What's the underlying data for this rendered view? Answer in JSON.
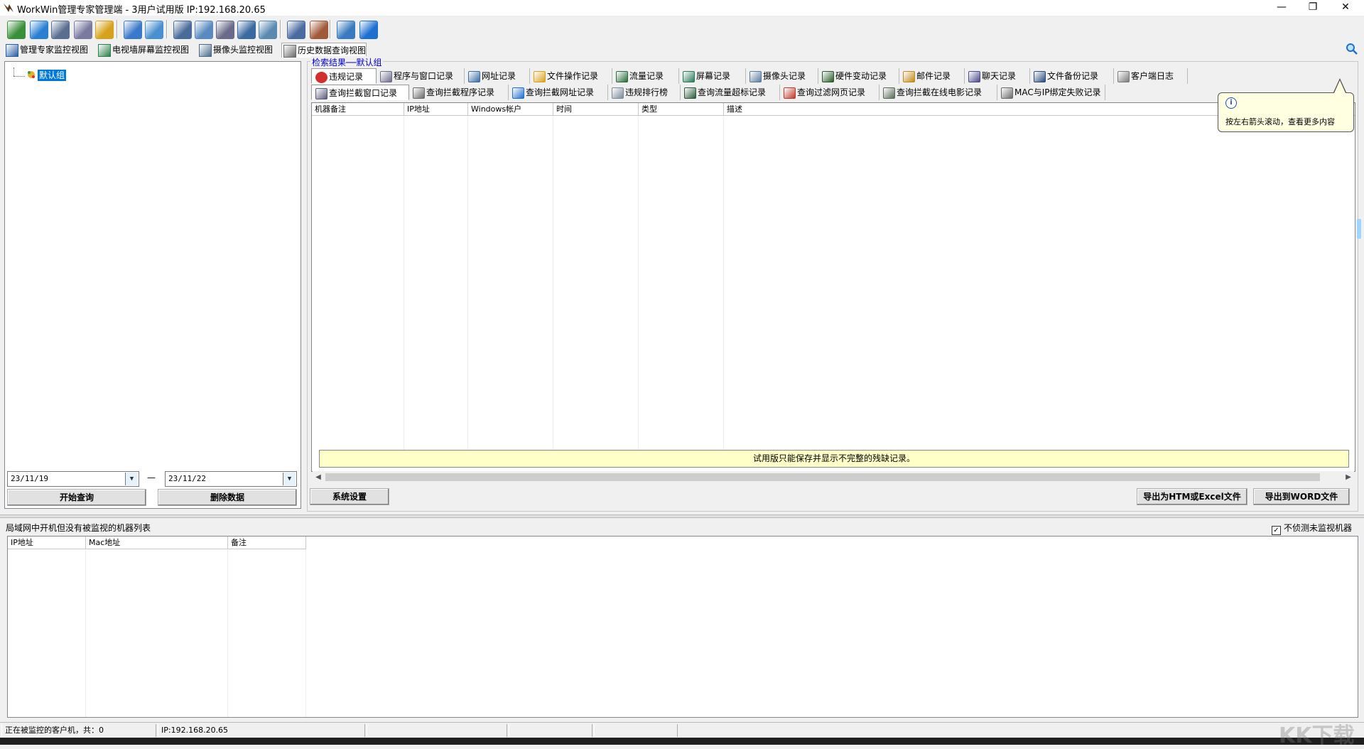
{
  "window": {
    "title": "WorkWin管理专家管理端 - 3用户试用版 IP:192.168.20.65",
    "minimize": "—",
    "restore": "❐",
    "close": "✕"
  },
  "toolbar": {
    "icons": [
      {
        "name": "monitor-stack-icon",
        "color": "#3a8f3a"
      },
      {
        "name": "globe-icon",
        "color": "#2a7fd4"
      },
      {
        "name": "screen-settings-icon",
        "color": "#5a6f8f"
      },
      {
        "name": "mail-icon",
        "color": "#7a7aa0"
      },
      {
        "name": "users-icon",
        "color": "#d6a21b"
      },
      {
        "name": "network-icon",
        "color": "#3a79c9"
      },
      {
        "name": "usb-icon",
        "color": "#4a8fd0"
      },
      {
        "name": "remote-screen-icon",
        "color": "#4a6a9a"
      },
      {
        "name": "send-icon",
        "color": "#5a8ac0"
      },
      {
        "name": "document-search-icon",
        "color": "#6a6a8a"
      },
      {
        "name": "copy-windows-icon",
        "color": "#3a6aa0"
      },
      {
        "name": "disc-icon",
        "color": "#5a8ab0"
      },
      {
        "name": "list-view-icon",
        "color": "#4a6aa0"
      },
      {
        "name": "report-icon",
        "color": "#a05a3a"
      },
      {
        "name": "keyboard-icon",
        "color": "#3a7ac0"
      },
      {
        "name": "help-icon",
        "color": "#1e6fd0"
      }
    ]
  },
  "view_tabs": [
    {
      "label": "管理专家监控视图",
      "icon": "monitor-expert-icon",
      "color": "#2a5fa0"
    },
    {
      "label": "电视墙屏幕监控视图",
      "icon": "tv-wall-icon",
      "color": "#2a7f4a"
    },
    {
      "label": "摄像头监控视图",
      "icon": "camera-icon",
      "color": "#4a6a8a"
    },
    {
      "label": "历史数据查询视图",
      "icon": "history-icon",
      "color": "#6a6a6a"
    }
  ],
  "search_icon": "search-icon",
  "tree": {
    "root": "默认组"
  },
  "query": {
    "start_date": "23/11/19",
    "dash": "—",
    "end_date": "23/11/22",
    "dropdown_arrow": "▼",
    "start_button": "开始查询",
    "delete_button": "删除数据"
  },
  "results": {
    "group_label": "检索结果──默认组",
    "tabs_row1": [
      {
        "label": "违规记录",
        "icon": "violation-icon",
        "color": "#d32f2f"
      },
      {
        "label": "程序与窗口记录",
        "icon": "program-window-icon",
        "color": "#6a6a8a"
      },
      {
        "label": "网址记录",
        "icon": "url-icon",
        "color": "#3a6aa0"
      },
      {
        "label": "文件操作记录",
        "icon": "file-operation-icon",
        "color": "#d6a21b"
      },
      {
        "label": "流量记录",
        "icon": "traffic-icon",
        "color": "#2a6a3a"
      },
      {
        "label": "屏幕记录",
        "icon": "screen-record-icon",
        "color": "#2a7a5a"
      },
      {
        "label": "摄像头记录",
        "icon": "camera-record-icon",
        "color": "#5a7a9a"
      },
      {
        "label": "硬件变动记录",
        "icon": "hardware-icon",
        "color": "#2a5a2a"
      },
      {
        "label": "邮件记录",
        "icon": "mail-record-icon",
        "color": "#c08a1a"
      },
      {
        "label": "聊天记录",
        "icon": "chat-icon",
        "color": "#4a4a8a"
      },
      {
        "label": "文件备份记录",
        "icon": "file-backup-icon",
        "color": "#2a4a7a"
      },
      {
        "label": "客户端日志",
        "icon": "client-log-icon",
        "color": "#7a7a7a"
      }
    ],
    "tabs_row2": [
      {
        "label": "查询拦截窗口记录",
        "icon": "blocked-window-icon",
        "color": "#5a5a7a"
      },
      {
        "label": "查询拦截程序记录",
        "icon": "blocked-program-icon",
        "color": "#6a6a6a"
      },
      {
        "label": "查询拦截网址记录",
        "icon": "blocked-url-icon",
        "color": "#1e6fd0"
      },
      {
        "label": "违规排行榜",
        "icon": "ranking-icon",
        "color": "#7a8a9a"
      },
      {
        "label": "查询流量超标记录",
        "icon": "traffic-exceed-icon",
        "color": "#2a5a3a"
      },
      {
        "label": "查询过滤网页记录",
        "icon": "filtered-page-icon",
        "color": "#c0392b"
      },
      {
        "label": "查询拦截在线电影记录",
        "icon": "blocked-movie-icon",
        "color": "#5a6a5a"
      },
      {
        "label": "MAC与IP绑定失败记录",
        "icon": "mac-ip-icon",
        "color": "#6a6a6a"
      }
    ],
    "columns": [
      "机器备注",
      "IP地址",
      "Windows帐户",
      "时间",
      "类型",
      "描述"
    ],
    "trial_note": "试用版只能保存并显示不完整的残缺记录。",
    "scroll_left": "◀",
    "scroll_right": "▶",
    "settings_button": "系统设置",
    "export_html_button": "导出为HTM或Excel文件",
    "export_word_button": "导出到WORD文件"
  },
  "tooltip": {
    "icon": "i",
    "text": "按左右箭头滚动，查看更多内容"
  },
  "bottom": {
    "label": "局域网中开机但没有被监视的机器列表",
    "checkbox_label": "不侦测未监视机器",
    "checkbox_checked": "✓",
    "columns": [
      "IP地址",
      "Mac地址",
      "备注"
    ]
  },
  "statusbar": {
    "monitored": "正在被监控的客户机，共：0",
    "ip": "IP:192.168.20.65"
  },
  "watermark": "KK下载"
}
